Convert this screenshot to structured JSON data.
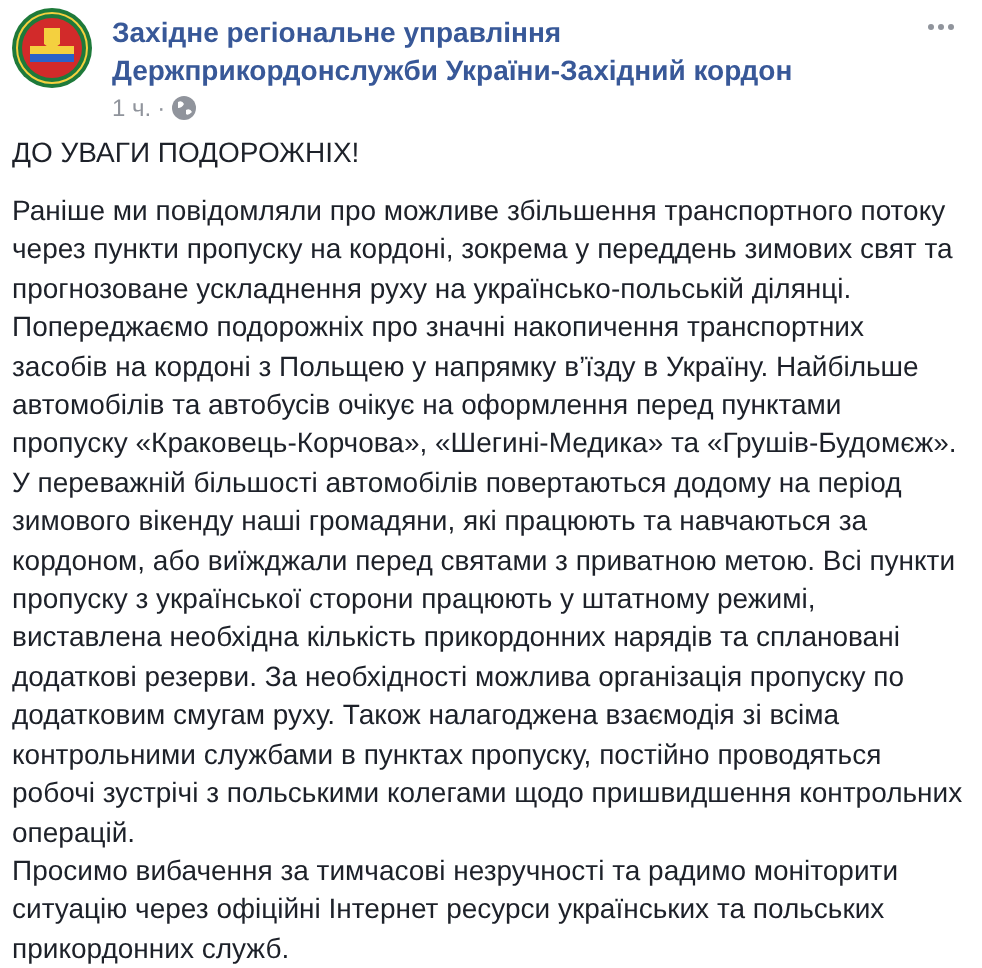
{
  "post": {
    "author": "Західне регіональне управління Держприкордонслужби України-Західний кордон",
    "time": "1 ч.",
    "separator": "·",
    "headline": "ДО УВАГИ ПОДОРОЖНІХ!",
    "paragraphs": [
      {
        "lines": [
          "Раніше ми повідомляли про можливе збільшення транспортного потоку",
          "через пункти пропуску на кордоні, зокрема у переддень зимових свят та",
          "прогнозоване ускладнення руху на українсько-польській ділянці.",
          "Попереджаємо подорожніх про значні накопичення транспортних",
          "засобів на кордоні з Польщею у напрямку в’їзду в Україну. Найбільше",
          "автомобілів та автобусів очікує на оформлення перед пунктами",
          "пропуску «Краковець-Корчова», «Шегині-Медика» та «Грушів-Будомєж».",
          "У переважній більшості автомобілів повертаються додому на період",
          "зимового вікенду наші громадяни, які працюють та навчаються за",
          "кордоном, або виїжджали перед святами з приватною метою. Всі пункти",
          "пропуску з української сторони працюють у штатному режимі,",
          "виставлена необхідна кількість прикордонних нарядів та сплановані",
          "додаткові резерви. За необхідності можлива організація пропуску по",
          "додатковим смугам руху. Також налагоджена взаємодія зі всіма",
          "контрольними службами в пунктах пропуску, постійно проводяться",
          "робочі зустрічі з польськими колегами щодо пришвидшення контрольних",
          "операцій."
        ]
      },
      {
        "lines": [
          "Просимо вибачення за тимчасові незручності та радимо моніторити",
          "ситуацію через офіційні Інтернет ресурси українських та польських",
          "прикордонних служб."
        ]
      }
    ]
  }
}
